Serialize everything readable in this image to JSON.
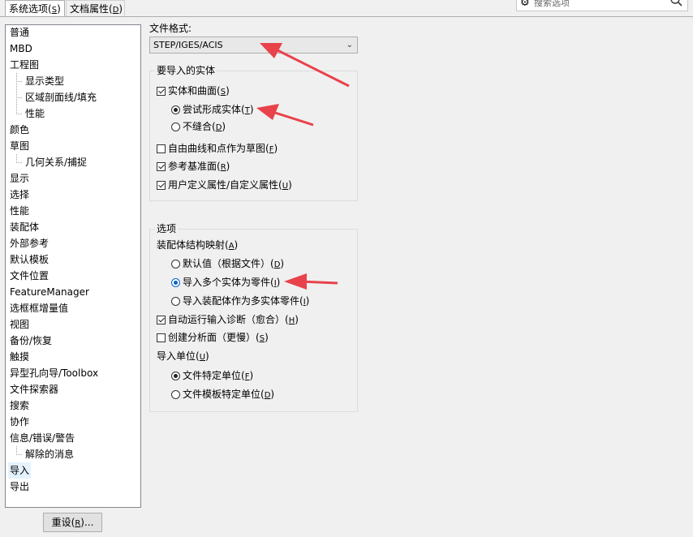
{
  "tabs": [
    {
      "label": "系统选项",
      "key": "S"
    },
    {
      "label": "文档属性",
      "key": "D"
    }
  ],
  "search": {
    "placeholder": "搜索选项"
  },
  "tree": {
    "items": [
      {
        "label": "普通"
      },
      {
        "label": "MBD"
      },
      {
        "label": "工程图"
      },
      {
        "label": "显示类型"
      },
      {
        "label": "区域剖面线/填充"
      },
      {
        "label": "性能"
      },
      {
        "label": "颜色"
      },
      {
        "label": "草图"
      },
      {
        "label": "几何关系/捕捉"
      },
      {
        "label": "显示"
      },
      {
        "label": "选择"
      },
      {
        "label": "性能"
      },
      {
        "label": "装配体"
      },
      {
        "label": "外部参考"
      },
      {
        "label": "默认模板"
      },
      {
        "label": "文件位置"
      },
      {
        "label": "FeatureManager"
      },
      {
        "label": "选框框增量值"
      },
      {
        "label": "视图"
      },
      {
        "label": "备份/恢复"
      },
      {
        "label": "触摸"
      },
      {
        "label": "异型孔向导/Toolbox"
      },
      {
        "label": "文件探索器"
      },
      {
        "label": "搜索"
      },
      {
        "label": "协作"
      },
      {
        "label": "信息/错误/警告"
      },
      {
        "label": "解除的消息"
      },
      {
        "label": "导入"
      },
      {
        "label": "导出"
      }
    ]
  },
  "reset": {
    "label": "重设",
    "key": "R",
    "suffix": ")..."
  },
  "file_format": {
    "label": "文件格式:",
    "value": "STEP/IGES/ACIS"
  },
  "entities": {
    "title": "要导入的实体",
    "solids_surfaces": {
      "label": "实体和曲面",
      "key": "S",
      "checked": true
    },
    "try_solid": {
      "label": "尝试形成实体",
      "key": "T",
      "selected": true
    },
    "no_knit": {
      "label": "不缝合",
      "key": "D",
      "selected": false
    },
    "free_curves": {
      "label": "自由曲线和点作为草图",
      "key": "F",
      "checked": false
    },
    "ref_planes": {
      "label": "参考基准面",
      "key": "R",
      "checked": true
    },
    "user_props": {
      "label": "用户定义属性/自定义属性",
      "key": "U",
      "checked": true
    }
  },
  "options": {
    "title": "选项",
    "asm_mapping": {
      "label": "装配体结构映射",
      "key": "A"
    },
    "default_value": {
      "label": "默认值（根据文件）",
      "key": "D",
      "selected": false
    },
    "import_multi": {
      "label": "导入多个实体为零件",
      "key": "I",
      "selected": true
    },
    "import_asm": {
      "label": "导入装配体作为多实体零件",
      "key": "I",
      "selected": false
    },
    "auto_diag": {
      "label": "自动运行输入诊断（愈合）",
      "key": "H",
      "checked": true
    },
    "analysis": {
      "label": "创建分析面（更慢）",
      "key": "S",
      "checked": false
    },
    "units_label": {
      "label": "导入单位",
      "key": "U"
    },
    "file_units": {
      "label": "文件特定单位",
      "key": "F",
      "selected": true
    },
    "template_units": {
      "label": "文件模板特定单位",
      "key": "D",
      "selected": false
    }
  },
  "colors": {
    "arrow": "#e8424a",
    "selection": "#e5f3ff",
    "radio_accent": "#0a64c8"
  }
}
